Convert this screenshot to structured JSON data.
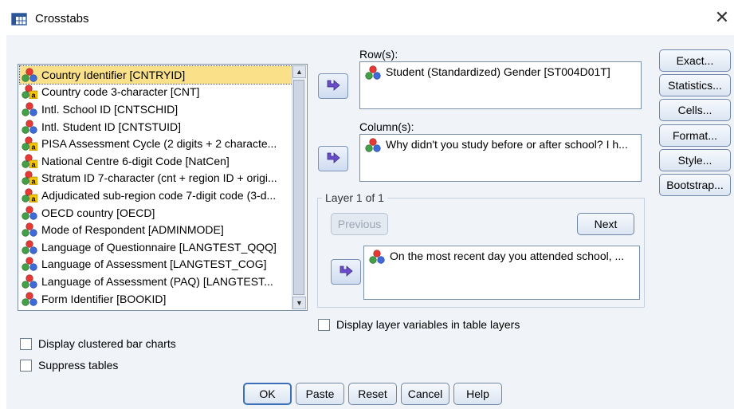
{
  "window": {
    "title": "Crosstabs",
    "close_glyph": "✕"
  },
  "variable_list": {
    "items": [
      {
        "label": "Country Identifier [CNTRYID]",
        "type": "nominal"
      },
      {
        "label": "Country code 3-character [CNT]",
        "type": "string"
      },
      {
        "label": "Intl. School ID [CNTSCHID]",
        "type": "nominal"
      },
      {
        "label": "Intl. Student ID [CNTSTUID]",
        "type": "nominal"
      },
      {
        "label": "PISA Assessment Cycle (2 digits + 2 characte...",
        "type": "string"
      },
      {
        "label": "National Centre 6-digit Code [NatCen]",
        "type": "string"
      },
      {
        "label": "Stratum ID 7-character (cnt + region ID + origi...",
        "type": "string"
      },
      {
        "label": "Adjudicated sub-region code 7-digit code (3-d...",
        "type": "string"
      },
      {
        "label": "OECD country [OECD]",
        "type": "nominal"
      },
      {
        "label": "Mode of Respondent [ADMINMODE]",
        "type": "nominal"
      },
      {
        "label": "Language of Questionnaire [LANGTEST_QQQ]",
        "type": "nominal"
      },
      {
        "label": "Language of Assessment [LANGTEST_COG]",
        "type": "nominal"
      },
      {
        "label": "Language of Assessment (PAQ) [LANGTEST...",
        "type": "nominal"
      },
      {
        "label": "Form Identifier [BOOKID]",
        "type": "nominal"
      }
    ]
  },
  "rows": {
    "label": "Row(s):",
    "value": "Student (Standardized) Gender [ST004D01T]"
  },
  "columns": {
    "label": "Column(s):",
    "value": "Why didn't you study before or after school? I h..."
  },
  "layer": {
    "title": "Layer 1 of 1",
    "previous_label": "Previous",
    "next_label": "Next",
    "value": "On the most recent day you attended school, ..."
  },
  "side_buttons": {
    "exact": "Exact...",
    "statistics": "Statistics...",
    "cells": "Cells...",
    "format": "Format...",
    "style": "Style...",
    "bootstrap": "Bootstrap..."
  },
  "checkboxes": {
    "display_layer": "Display layer variables in table layers",
    "clustered_bar": "Display clustered bar charts",
    "suppress_tables": "Suppress tables"
  },
  "bottom_buttons": {
    "ok": "OK",
    "paste": "Paste",
    "reset": "Reset",
    "cancel": "Cancel",
    "help": "Help"
  },
  "colors": {
    "accent": "#3d6fb8",
    "selected_row": "#fbe08a",
    "dialog_bg": "#f0f4f9",
    "arrow_purple": "#6a4cc8"
  }
}
